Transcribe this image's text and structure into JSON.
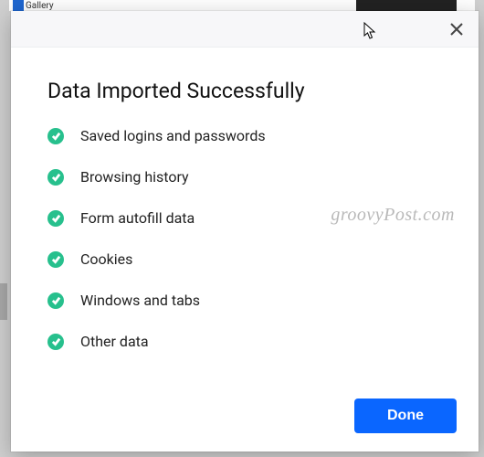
{
  "background": {
    "tab_label": "Gallery"
  },
  "dialog": {
    "title": "Data Imported Successfully",
    "items": [
      {
        "label": "Saved logins and passwords"
      },
      {
        "label": "Browsing history"
      },
      {
        "label": "Form autofill data"
      },
      {
        "label": "Cookies"
      },
      {
        "label": "Windows and tabs"
      },
      {
        "label": "Other data"
      }
    ],
    "done_label": "Done"
  },
  "watermark": "groovyPost.com"
}
